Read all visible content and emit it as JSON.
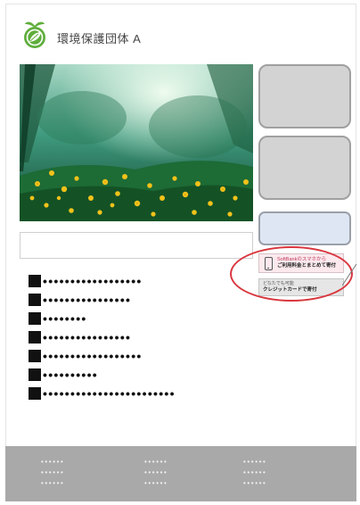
{
  "header": {
    "org_name": "環境保護団体 A",
    "logo_icon": "leaf-logo-icon"
  },
  "hero": {
    "image": "forest-wildflowers-photo"
  },
  "search": {
    "value": "",
    "placeholder": ""
  },
  "side_tiles": [
    {
      "label": ""
    },
    {
      "label": ""
    },
    {
      "label": ""
    }
  ],
  "payment": {
    "softbank_line1": "SoftBankのスマホから",
    "softbank_line2": "ご利用料金とまとめて寄付",
    "card_line1": "どなたでも可能",
    "card_line2": "クレジットカードで寄付"
  },
  "list_items": [
    "••••••••••••••••••",
    "••••••••••••••••",
    "••••••••",
    "••••••••••••••••",
    "••••••••••••••••••",
    "••••••••••",
    "••••••••••••••••••••••••"
  ],
  "footer": {
    "col1": [
      "••••••",
      "••••••",
      "••••••"
    ],
    "col2": [
      "••••••",
      "••••••",
      "••••••"
    ],
    "col3": [
      "••••••",
      "••••••",
      "••••••"
    ]
  },
  "colors": {
    "logo_green": "#5fae3c",
    "highlight_red": "#d9363e",
    "tile_gray": "#d3d3d3",
    "tile_blue": "#dfe6f3",
    "footer_gray": "#a9a9a9"
  }
}
